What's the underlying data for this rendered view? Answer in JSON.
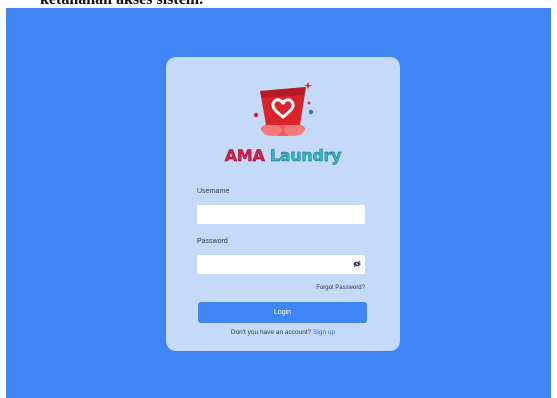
{
  "page": {
    "caption": "ketahanan akses sistem."
  },
  "login": {
    "brand_part1": "AMA",
    "brand_part2": "Laundry",
    "username_label": "Username",
    "username_value": "",
    "password_label": "Password",
    "password_value": "",
    "forgot_label": "Forgot Password?",
    "login_label": "Login",
    "signup_prompt": "Don't you have an account?",
    "signup_link": "Sign up"
  },
  "colors": {
    "background": "#3f86f4",
    "card": "#c5d9f8",
    "button": "#3f86f4",
    "brand_red": "#d81f4b",
    "brand_teal": "#2bb6c9"
  },
  "icons": {
    "logo": "laundry-basket-heart-icon",
    "password_toggle": "eye-icon"
  }
}
